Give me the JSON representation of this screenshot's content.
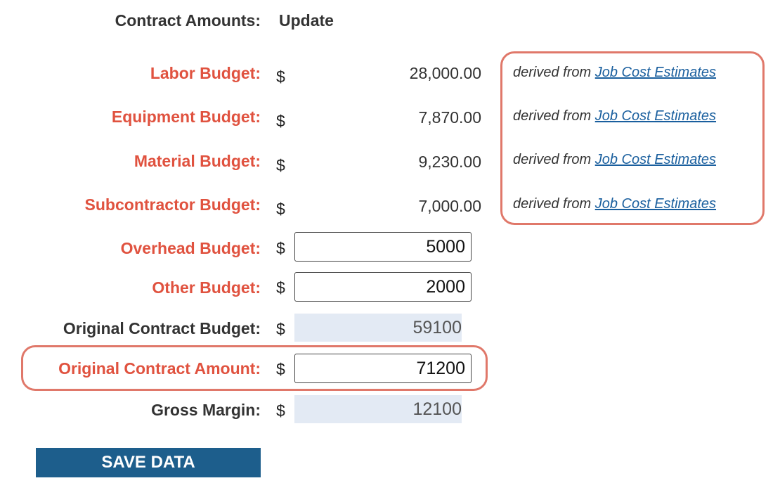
{
  "header": {
    "label": "Contract Amounts:",
    "value": "Update"
  },
  "currency_symbol": "$",
  "derived_note": {
    "prefix": "derived from",
    "link_text": "Job Cost Estimates"
  },
  "budgets": {
    "labor": {
      "label": "Labor Budget:",
      "value": "28,000.00"
    },
    "equipment": {
      "label": "Equipment Budget:",
      "value": "7,870.00"
    },
    "material": {
      "label": "Material Budget:",
      "value": "9,230.00"
    },
    "subcontractor": {
      "label": "Subcontractor Budget:",
      "value": "7,000.00"
    },
    "overhead": {
      "label": "Overhead Budget:",
      "value": "5000"
    },
    "other": {
      "label": "Other Budget:",
      "value": "2000"
    },
    "original_contract_budget": {
      "label": "Original Contract Budget:",
      "value": "59100"
    },
    "original_contract_amount": {
      "label": "Original Contract Amount:",
      "value": "71200"
    },
    "gross_margin": {
      "label": "Gross Margin:",
      "value": "12100"
    }
  },
  "save_button": {
    "label": "SAVE DATA"
  },
  "colors": {
    "required_label": "#e0523f",
    "highlight_border": "#e0786a",
    "button_bg": "#1d5e8c",
    "readonly_bg": "#e3eaf4",
    "link": "#1a5f9e"
  }
}
